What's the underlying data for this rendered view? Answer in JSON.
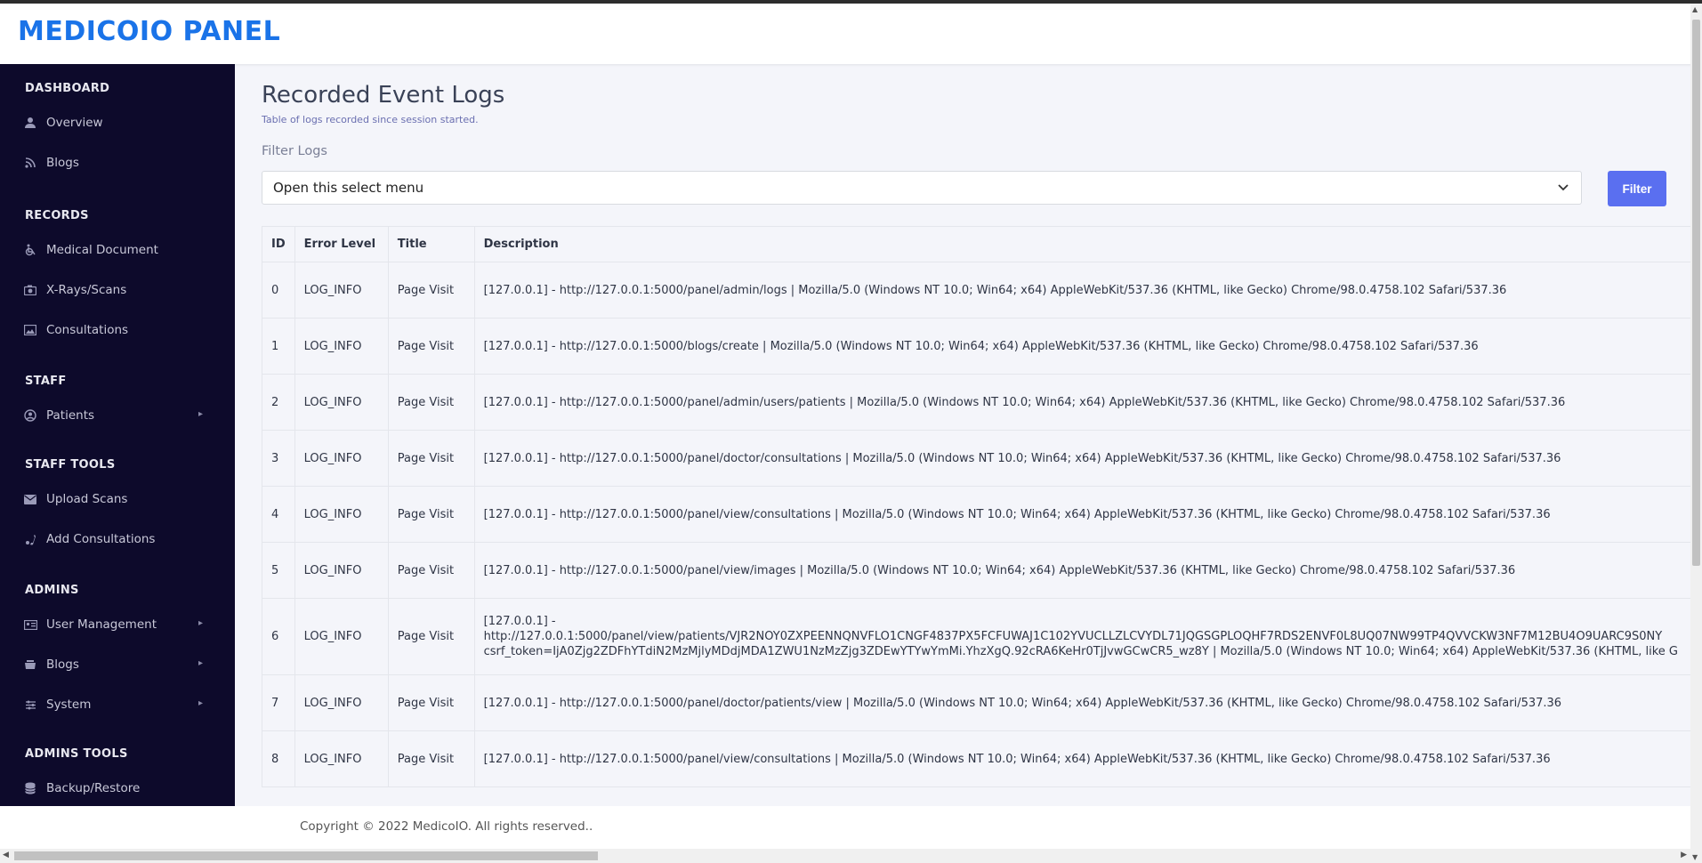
{
  "brand": "MEDICOIO PANEL",
  "sidebar": {
    "sections": [
      {
        "title": "DASHBOARD"
      },
      {
        "title": "RECORDS"
      },
      {
        "title": "STAFF"
      },
      {
        "title": "STAFF TOOLS"
      },
      {
        "title": "ADMINS"
      },
      {
        "title": "ADMINS TOOLS"
      }
    ],
    "items": [
      {
        "label": "Overview",
        "icon": "user-icon"
      },
      {
        "label": "Blogs",
        "icon": "rss-icon"
      },
      {
        "label": "Medical Document",
        "icon": "wheelchair-icon"
      },
      {
        "label": "X-Rays/Scans",
        "icon": "camera-icon"
      },
      {
        "label": "Consultations",
        "icon": "image-icon"
      },
      {
        "label": "Patients",
        "icon": "user-circle-icon",
        "has_submenu": true
      },
      {
        "label": "Upload Scans",
        "icon": "envelope-icon"
      },
      {
        "label": "Add Consultations",
        "icon": "phone-icon"
      },
      {
        "label": "User Management",
        "icon": "id-card-icon",
        "has_submenu": true
      },
      {
        "label": "Blogs",
        "icon": "layers-icon",
        "has_submenu": true
      },
      {
        "label": "System",
        "icon": "sliders-icon",
        "has_submenu": true
      },
      {
        "label": "Backup/Restore",
        "icon": "database-icon"
      }
    ]
  },
  "main": {
    "title": "Recorded Event Logs",
    "subtitle": "Table of logs recorded since session started.",
    "filter_label": "Filter Logs",
    "select_value": "Open this select menu",
    "filter_button": "Filter",
    "table": {
      "headers": [
        "ID",
        "Error Level",
        "Title",
        "Description"
      ],
      "rows": [
        {
          "id": "0",
          "level": "LOG_INFO",
          "title": "Page Visit",
          "desc": "[127.0.0.1] - http://127.0.0.1:5000/panel/admin/logs | Mozilla/5.0 (Windows NT 10.0; Win64; x64) AppleWebKit/537.36 (KHTML, like Gecko) Chrome/98.0.4758.102 Safari/537.36"
        },
        {
          "id": "1",
          "level": "LOG_INFO",
          "title": "Page Visit",
          "desc": "[127.0.0.1] - http://127.0.0.1:5000/blogs/create | Mozilla/5.0 (Windows NT 10.0; Win64; x64) AppleWebKit/537.36 (KHTML, like Gecko) Chrome/98.0.4758.102 Safari/537.36"
        },
        {
          "id": "2",
          "level": "LOG_INFO",
          "title": "Page Visit",
          "desc": "[127.0.0.1] - http://127.0.0.1:5000/panel/admin/users/patients | Mozilla/5.0 (Windows NT 10.0; Win64; x64) AppleWebKit/537.36 (KHTML, like Gecko) Chrome/98.0.4758.102 Safari/537.36"
        },
        {
          "id": "3",
          "level": "LOG_INFO",
          "title": "Page Visit",
          "desc": "[127.0.0.1] - http://127.0.0.1:5000/panel/doctor/consultations | Mozilla/5.0 (Windows NT 10.0; Win64; x64) AppleWebKit/537.36 (KHTML, like Gecko) Chrome/98.0.4758.102 Safari/537.36"
        },
        {
          "id": "4",
          "level": "LOG_INFO",
          "title": "Page Visit",
          "desc": "[127.0.0.1] - http://127.0.0.1:5000/panel/view/consultations | Mozilla/5.0 (Windows NT 10.0; Win64; x64) AppleWebKit/537.36 (KHTML, like Gecko) Chrome/98.0.4758.102 Safari/537.36"
        },
        {
          "id": "5",
          "level": "LOG_INFO",
          "title": "Page Visit",
          "desc": "[127.0.0.1] - http://127.0.0.1:5000/panel/view/images | Mozilla/5.0 (Windows NT 10.0; Win64; x64) AppleWebKit/537.36 (KHTML, like Gecko) Chrome/98.0.4758.102 Safari/537.36"
        },
        {
          "id": "6",
          "level": "LOG_INFO",
          "title": "Page Visit",
          "desc_lines": [
            "[127.0.0.1] -",
            "http://127.0.0.1:5000/panel/view/patients/VJR2NOY0ZXPEENNQNVFLO1CNGF4837PX5FCFUWAJ1C102YVUCLLZLCVYDL71JQGSGPLOQHF7RDS2ENVF0L8UQ07NW99TP4QVVCKW3NF7M12BU4O9UARC9S0NY",
            "csrf_token=IjA0Zjg2ZDFhYTdiN2MzMjlyMDdjMDA1ZWU1NzMzZjg3ZDEwYTYwYmMi.YhzXgQ.92cRA6KeHr0TjJvwGCwCR5_wz8Y | Mozilla/5.0 (Windows NT 10.0; Win64; x64) AppleWebKit/537.36 (KHTML, like G"
          ]
        },
        {
          "id": "7",
          "level": "LOG_INFO",
          "title": "Page Visit",
          "desc": "[127.0.0.1] - http://127.0.0.1:5000/panel/doctor/patients/view | Mozilla/5.0 (Windows NT 10.0; Win64; x64) AppleWebKit/537.36 (KHTML, like Gecko) Chrome/98.0.4758.102 Safari/537.36"
        },
        {
          "id": "8",
          "level": "LOG_INFO",
          "title": "Page Visit",
          "desc": "[127.0.0.1] - http://127.0.0.1:5000/panel/view/consultations | Mozilla/5.0 (Windows NT 10.0; Win64; x64) AppleWebKit/537.36 (KHTML, like Gecko) Chrome/98.0.4758.102 Safari/537.36"
        }
      ]
    }
  },
  "footer": "Copyright © 2022 MedicoIO. All rights reserved..",
  "colors": {
    "brand": "#1a73e8",
    "sidebar_bg": "#0d0a2b",
    "accent": "#5a6ff0"
  }
}
